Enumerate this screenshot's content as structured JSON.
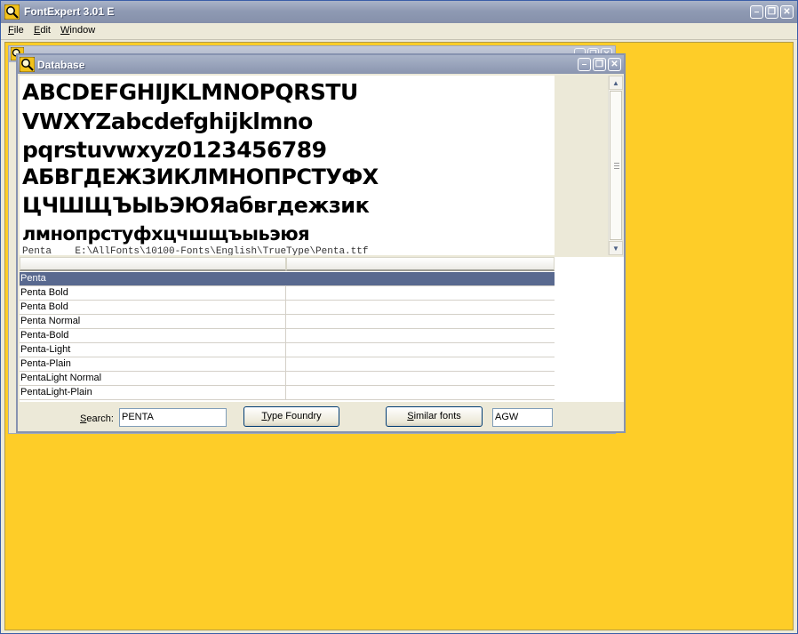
{
  "app": {
    "title": "FontExpert 3.01 E",
    "menu": [
      {
        "label_u": "F",
        "label_rest": "ile"
      },
      {
        "label_u": "E",
        "label_rest": "dit"
      },
      {
        "label_u": "W",
        "label_rest": "indow"
      }
    ],
    "window_controls": {
      "minimize": "–",
      "restore": "❐",
      "close": "✕"
    }
  },
  "database_window": {
    "title": "Database",
    "preview": {
      "lines": [
        "ABCDEFGHIJKLMNOPQRSTU",
        "VWXYZabcdefghijklmno",
        "pqrstuvwxyz0123456789",
        "АБВГДЕЖЗИКЛМНОПРСТУФХ",
        "ЦЧШЩЪЫЬЭЮЯабвгдежзик",
        "лмнопрстуфхцчшщъыьэюя"
      ],
      "path": "Penta    E:\\AllFonts\\10100-Fonts\\English\\TrueType\\Penta.ttf"
    },
    "table": {
      "rows": [
        "Penta",
        "Penta Bold",
        "Penta Bold",
        "Penta Normal",
        "Penta-Bold",
        "Penta-Light",
        "Penta-Plain",
        "PentaLight Normal",
        "PentaLight-Plain"
      ],
      "selected_index": 0
    },
    "search": {
      "label_u": "S",
      "label_rest": "earch:",
      "value": "PENTA"
    },
    "type_foundry_button": {
      "label_u": "T",
      "label_rest": "ype Foundry"
    },
    "similar_fonts_button": {
      "label_u": "S",
      "label_rest": "imilar fonts"
    },
    "sample_text": {
      "value": "AGW"
    }
  },
  "colors": {
    "mdi_background": "#fecd28",
    "selection": "#59698f",
    "title_bar": "#8f9ab3"
  }
}
